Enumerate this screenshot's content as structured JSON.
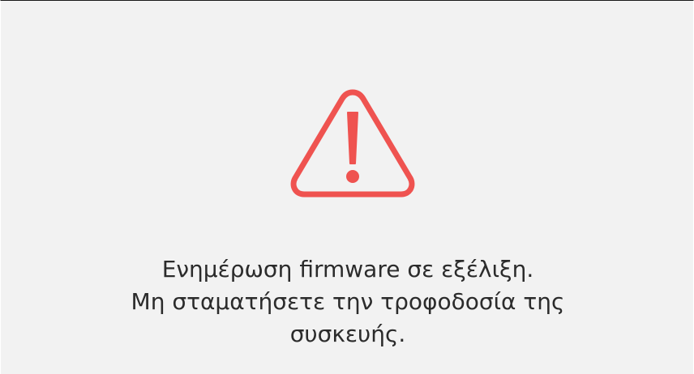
{
  "icons": {
    "warning": "warning-triangle-icon"
  },
  "colors": {
    "background": "#f2f2f2",
    "warning": "#ef5350",
    "text": "#2b2b2b"
  },
  "message": {
    "line1": "Ενημέρωση firmware σε εξέλιξη.",
    "line2": "Μη σταματήσετε την τροφοδοσία της",
    "line3": "συσκευής."
  }
}
